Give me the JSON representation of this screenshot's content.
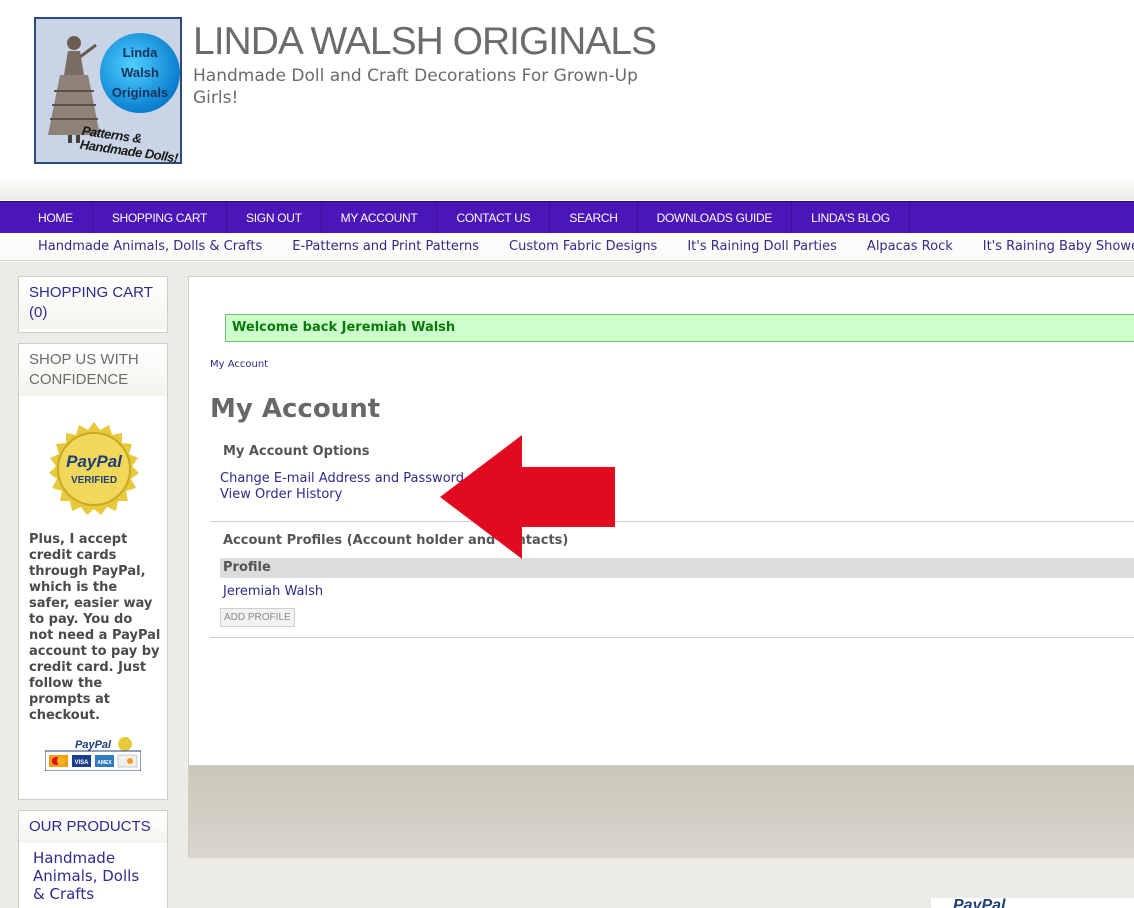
{
  "header": {
    "site_title": "LINDA WALSH ORIGINALS",
    "tagline": "Handmade Doll and Craft Decorations For Grown-Up Girls!",
    "logo": {
      "circle_text": [
        "Linda",
        "Walsh",
        "Originals"
      ],
      "caption": "Patterns & Handmade Dolls!"
    }
  },
  "main_nav": [
    "HOME",
    "SHOPPING CART",
    "SIGN OUT",
    "MY ACCOUNT",
    "CONTACT US",
    "SEARCH",
    "DOWNLOADS GUIDE",
    "LINDA'S BLOG"
  ],
  "categories": [
    "Handmade Animals, Dolls & Crafts",
    "E-Patterns and Print Patterns",
    "Custom Fabric Designs",
    "It's Raining Doll Parties",
    "Alpacas Rock",
    "It's Raining Baby Showers"
  ],
  "sidebar": {
    "cart": {
      "title": "SHOPPING CART",
      "count": "(0)"
    },
    "confidence": {
      "title": "SHOP US WITH CONFIDENCE",
      "seal_line1": "PayPal",
      "seal_line2": "VERIFIED",
      "text": "Plus, I accept credit cards through PayPal, which is the safer, easier way to pay. You do not need a PayPal account to pay by credit card. Just follow the prompts at checkout.",
      "cards_logo": "PayPal",
      "cards": [
        "VISA",
        "AMEX"
      ]
    },
    "products": {
      "title": "OUR PRODUCTS",
      "items": [
        "Handmade Animals, Dolls & Crafts"
      ]
    }
  },
  "content": {
    "welcome": "Welcome back Jeremiah Walsh",
    "breadcrumb": "My Account",
    "heading": "My Account",
    "options_title": "My Account Options",
    "options": [
      "Change E-mail Address and Password",
      "View Order History"
    ],
    "profiles_title": "Account Profiles (Account holder and contacts)",
    "profile_column": "Profile",
    "profile_name": "Jeremiah Walsh",
    "add_profile_button": "ADD PROFILE"
  },
  "footer": {
    "paypal_stub": "PayPal"
  },
  "colors": {
    "nav_bg": "#4a16b8",
    "link": "#2c2c8c",
    "welcome_bg": "#ccffcc",
    "welcome_text": "#0a7a0a",
    "arrow": "#e10a1e",
    "page_bg": "#ecebe5"
  }
}
